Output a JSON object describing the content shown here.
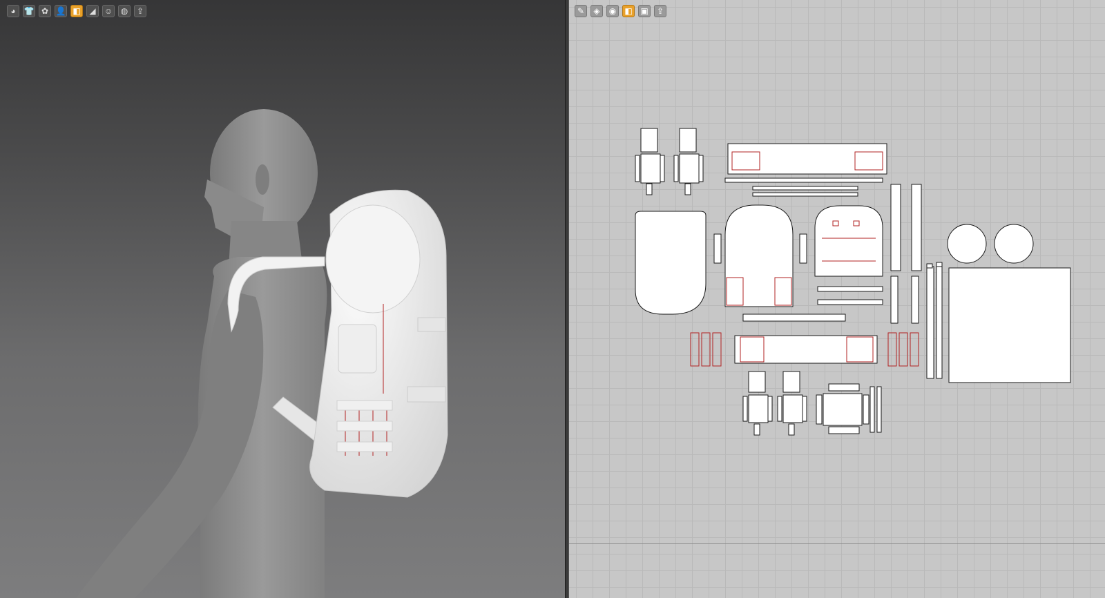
{
  "viewport_3d": {
    "toolbar": [
      {
        "icon": "avatar-display-icon",
        "glyph": "◕",
        "active": false
      },
      {
        "icon": "garment-display-icon",
        "glyph": "👕",
        "active": false
      },
      {
        "icon": "fabric-texture-icon",
        "glyph": "✿",
        "active": false
      },
      {
        "icon": "avatar-pose-icon",
        "glyph": "👤",
        "active": false
      },
      {
        "icon": "pattern-display-icon",
        "glyph": "◧",
        "active": true
      },
      {
        "icon": "pin-icon",
        "glyph": "◢",
        "active": false
      },
      {
        "icon": "avatar-skin-icon",
        "glyph": "☺",
        "active": false
      },
      {
        "icon": "globe-icon",
        "glyph": "◍",
        "active": false
      },
      {
        "icon": "export-icon",
        "glyph": "⇪",
        "active": false
      }
    ]
  },
  "viewport_2d": {
    "toolbar": [
      {
        "icon": "edit-pattern-icon",
        "glyph": "✎",
        "active": false
      },
      {
        "icon": "pattern-style-icon",
        "glyph": "◈",
        "active": false
      },
      {
        "icon": "zoom-pattern-icon",
        "glyph": "◉",
        "active": false
      },
      {
        "icon": "texture-display-icon",
        "glyph": "◧",
        "active": true
      },
      {
        "icon": "pattern-copy-icon",
        "glyph": "▣",
        "active": false
      },
      {
        "icon": "export-2d-icon",
        "glyph": "⇪",
        "active": false
      }
    ]
  },
  "colors": {
    "seam_line": "#b22222",
    "pattern_outline": "#1a1a1a",
    "pattern_fill": "#ffffff",
    "avatar": "#8d8d8d",
    "backpack": "#ececec",
    "active_tool": "#e9a12a"
  }
}
